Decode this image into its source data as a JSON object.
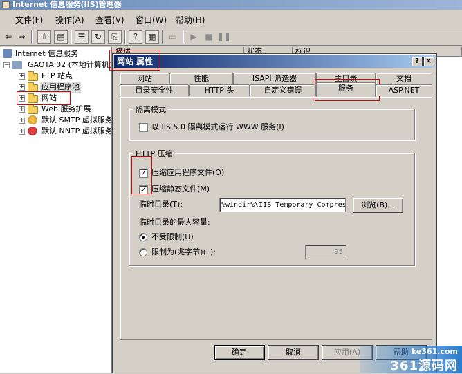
{
  "window": {
    "title": "Internet 信息服务(IIS)管理器"
  },
  "menu": [
    "文件(F)",
    "操作(A)",
    "查看(V)",
    "窗口(W)",
    "帮助(H)"
  ],
  "toolbar": {
    "icons": [
      "back-arrow-icon",
      "forward-arrow-icon",
      "up-folder-icon",
      "show-tree-icon",
      "properties-icon",
      "refresh-icon",
      "export-icon",
      "help-icon",
      "list-view-icon",
      "computer-icon",
      "play-icon",
      "stop-icon",
      "pause-icon"
    ]
  },
  "tree": {
    "root": "Internet 信息服务",
    "computer": "GAOTAI02 (本地计算机)",
    "items": [
      "FTP 站点",
      "应用程序池",
      "网站",
      "Web 服务扩展",
      "默认 SMTP 虚拟服务器",
      "默认 NNTP 虚拟服务器"
    ]
  },
  "list_pane": {
    "columns": [
      "描述",
      "状态",
      "标识"
    ]
  },
  "dialog": {
    "title": "网站 属性",
    "help_button": "?",
    "close_button": "×",
    "tabs_back": [
      "网站",
      "性能",
      "ISAPI 筛选器",
      "主目录",
      "文档"
    ],
    "tabs_front": [
      "目录安全性",
      "HTTP 头",
      "自定义错误",
      "服务",
      "ASP.NET"
    ],
    "active_tab": "服务",
    "isolation_group": {
      "title": "隔离模式",
      "iis5_checkbox_label": "以 IIS 5.0 隔离模式运行 WWW 服务(I)",
      "iis5_checked": false
    },
    "compression_group": {
      "title": "HTTP 压缩",
      "compress_app_label": "压缩应用程序文件(O)",
      "compress_app_checked": true,
      "compress_static_label": "压缩静态文件(M)",
      "compress_static_checked": true,
      "temp_dir_label": "临时目录(T):",
      "temp_dir_value": "%windir%\\IIS Temporary Compres",
      "browse_button": "浏览(B)...",
      "max_size_label": "临时目录的最大容量:",
      "unlimited_label": "不受限制(U)",
      "limit_label": "限制为(兆字节)(L):",
      "limit_value": "95",
      "selected_option": "unlimited"
    },
    "buttons": {
      "ok": "确定",
      "cancel": "取消",
      "apply": "应用(A)",
      "help": "帮助"
    }
  },
  "watermark": {
    "url": "ke361.com",
    "brand": "361源码网"
  },
  "colors": {
    "annotation_red": "#e00000",
    "dialog_title_start": "#0a246a",
    "dialog_title_end": "#a6caf0"
  }
}
